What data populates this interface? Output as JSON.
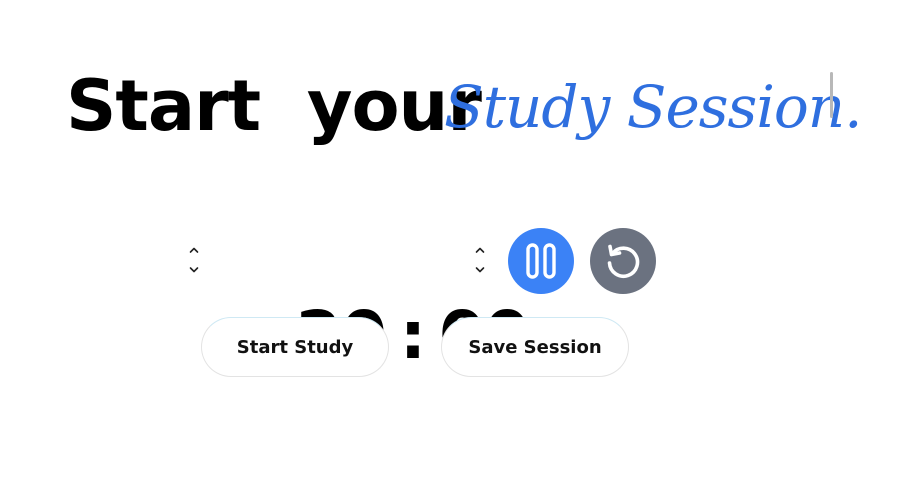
{
  "heading": {
    "plain_text": "Start  your",
    "script_text": "Study Session."
  },
  "timer": {
    "minutes": "20",
    "separator": ":",
    "seconds": "00"
  },
  "controls": {
    "pause_icon": "pause-icon",
    "reset_icon": "reset-icon",
    "spinner_up_icon": "chevron-up-icon",
    "spinner_down_icon": "chevron-down-icon"
  },
  "actions": {
    "start_study_label": "Start Study",
    "save_session_label": "Save Session"
  },
  "colors": {
    "accent": "#3b82f6",
    "script_text": "#2f6fdf",
    "reset_button": "#6b7280",
    "text": "#000000"
  }
}
